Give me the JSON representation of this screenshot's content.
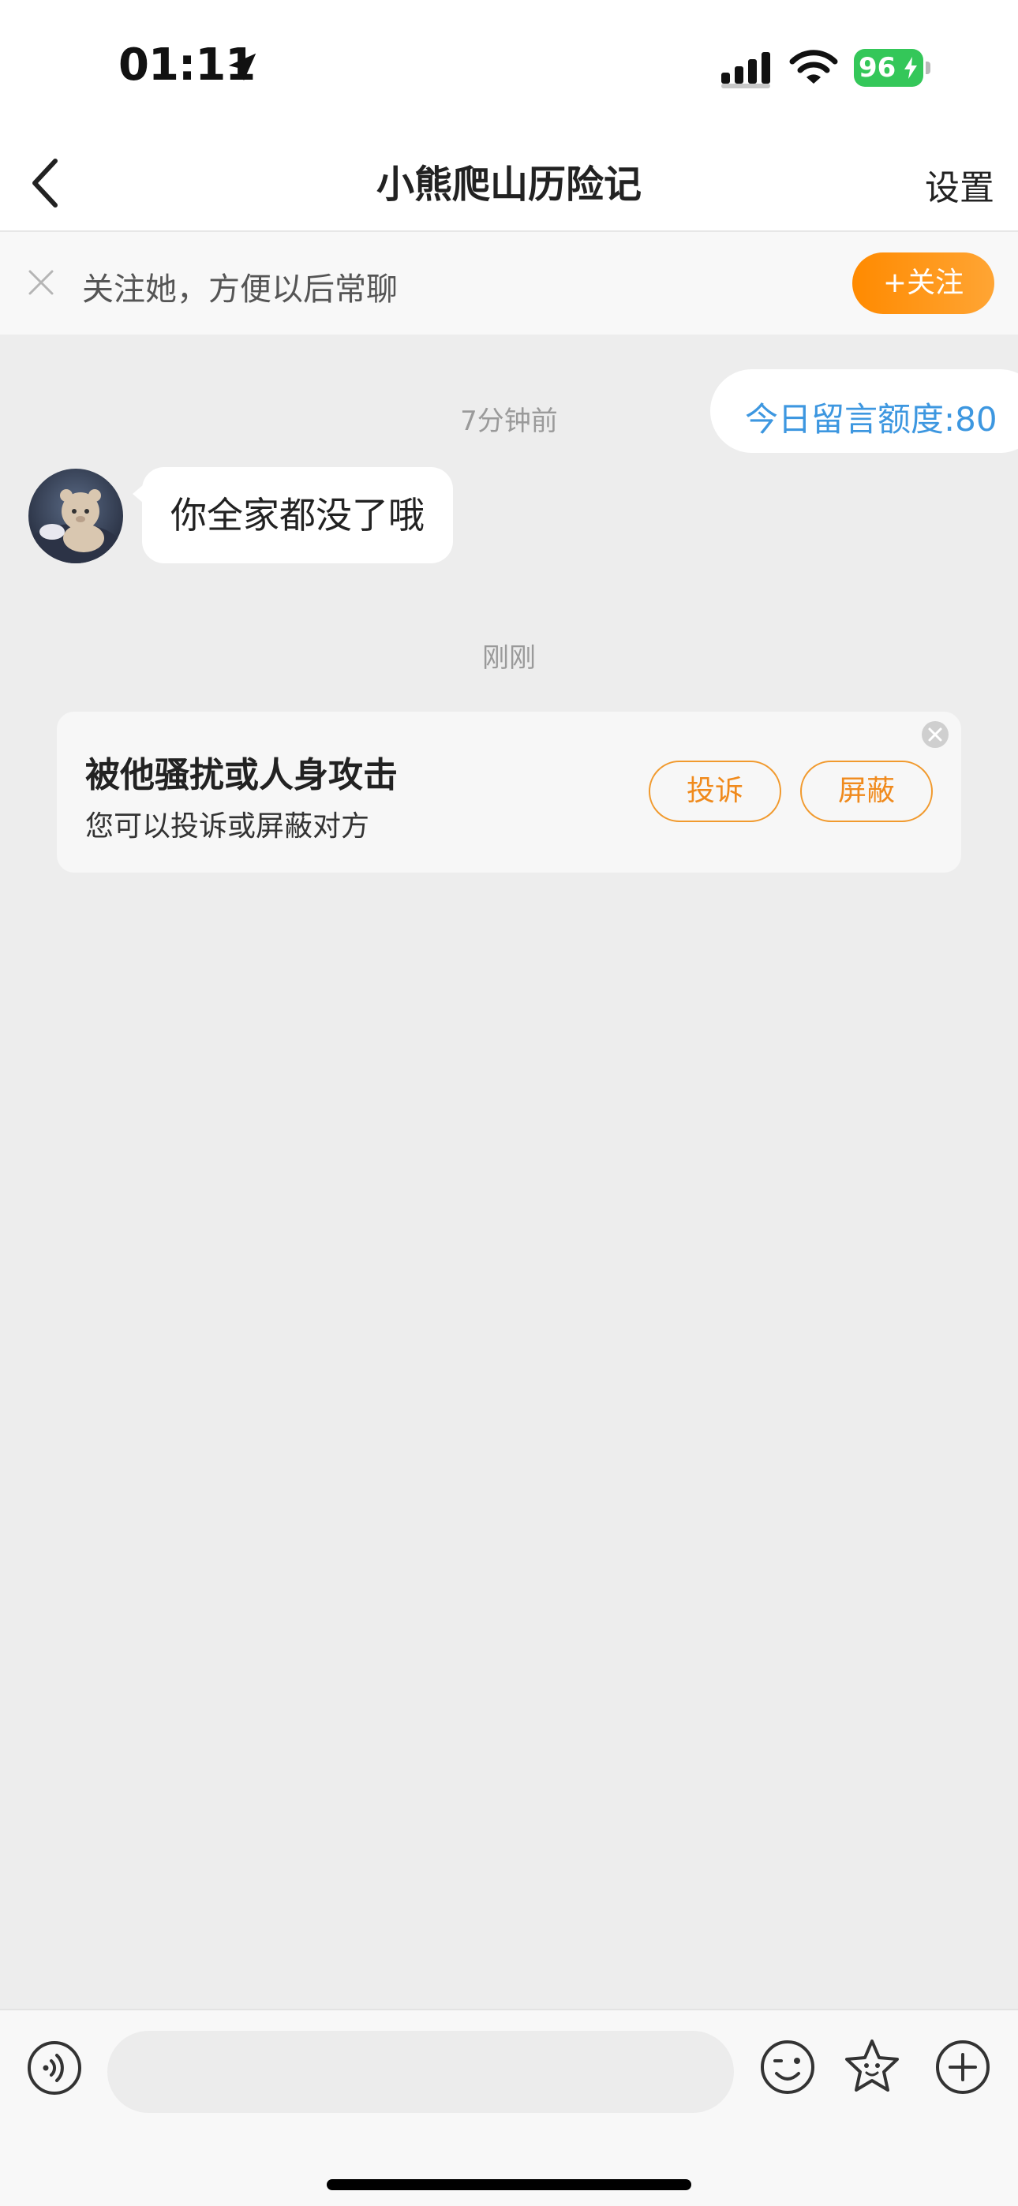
{
  "status_bar": {
    "time": "01:11",
    "battery": "96",
    "battery_color": "#34c759"
  },
  "nav": {
    "title": "小熊爬山历险记",
    "settings": "设置",
    "back_icon": "chevron-left-icon"
  },
  "follow_bar": {
    "text": "关注她，方便以后常聊",
    "button": "+关注",
    "accent": "#ff8a00"
  },
  "chat": {
    "quota": "今日留言额度:80",
    "quota_color": "#3d97e0",
    "time_1": "7分钟前",
    "message": "你全家都没了哦",
    "time_2": "刚刚"
  },
  "report_card": {
    "title": "被他骚扰或人身攻击",
    "subtitle": "您可以投诉或屏蔽对方",
    "complain": "投诉",
    "block": "屏蔽",
    "button_color": "#f08a1c"
  },
  "input_bar": {
    "placeholder": "",
    "icons": [
      "voice-icon",
      "emoji-icon",
      "sticker-icon",
      "plus-icon"
    ]
  }
}
